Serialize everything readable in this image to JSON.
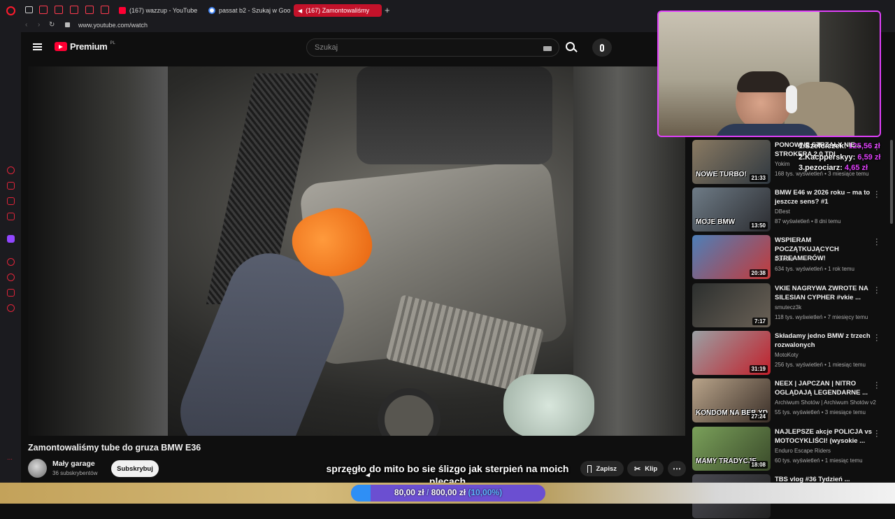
{
  "browser": {
    "tabs": [
      {
        "label": "(167) wazzup - YouTube",
        "favicon_color": "#ff0033"
      },
      {
        "label": "passat b2 - Szukaj w Goo",
        "favicon_color": "#4285f4"
      },
      {
        "label": "(167) Zamontowaliśmy",
        "favicon_color": "#ff0033",
        "active": true
      }
    ],
    "new_tab": "+",
    "url": "www.youtube.com/watch"
  },
  "yt": {
    "logo": "Premium",
    "region": "PL",
    "search_placeholder": "Szukaj"
  },
  "video": {
    "title": "Zamontowaliśmy tube do gruza BMW E36",
    "channel": "Mały garage",
    "subscribers": "36 subskrybentów",
    "subscribe_label": "Subskrybuj",
    "save_label": "Zapisz",
    "clip_label": "Klip"
  },
  "overlay": {
    "caption_line1": "sprzęgło do mito bo sie ślizgo jak sterpień na moich",
    "caption_line2": "plecach",
    "donation_text": "80,00 zł",
    "donation_separator": "/",
    "donation_goal": "800,00 zł",
    "donation_percent": "(10,00%)",
    "donation_progress": 0.1,
    "leaderboard": [
      {
        "name": "1.Szefciczek:",
        "amount": "125,56 zł"
      },
      {
        "name": "2.Kacpperskyy:",
        "amount": "6,59 zł"
      },
      {
        "name": "3.pezociarz:",
        "amount": "4,65 zł"
      }
    ]
  },
  "sidebar": {
    "items": [
      {
        "title": "PONOWNE STRZAŁY NIE... STROKERA 2.0 TDI",
        "channel": "Yokim",
        "meta": "168 tys. wyświetleń • 3 miesiące temu",
        "duration": "21:33",
        "thumb_text": "NOWE TURBO!",
        "thumb_colors": [
          "#8a7a62",
          "#2f3840"
        ]
      },
      {
        "title": "BMW E46 w 2026 roku – ma to jeszcze sens? #1",
        "channel": "DBest",
        "meta": "87 wyświetleń • 8 dni temu",
        "duration": "13:50",
        "thumb_text": "MOJE BMW",
        "thumb_colors": [
          "#6e7b86",
          "#2b2c30"
        ]
      },
      {
        "title": "WSPIERAM POCZĄTKUJĄCYCH STREAMERÓW!",
        "channel": "Dzinold",
        "meta": "634 tys. wyświetleń • 1 rok temu",
        "duration": "20:38",
        "thumb_text": "",
        "thumb_colors": [
          "#4d7fb8",
          "#c43a3a"
        ]
      },
      {
        "title": "VKIE NAGRYWA ZWROTE NA SILESIAN CYPHER #vkie ...",
        "channel": "smutecz3k",
        "meta": "118 tys. wyświetleń • 7 miesięcy temu",
        "duration": "7:17",
        "thumb_text": "",
        "thumb_colors": [
          "#2c2f2e",
          "#6a6156"
        ]
      },
      {
        "title": "Składamy jedno BMW z trzech rozwalonych",
        "channel": "MotoKoty",
        "meta": "256 tys. wyświetleń • 1 miesiąc temu",
        "duration": "31:19",
        "thumb_text": "",
        "thumb_colors": [
          "#9aa0a4",
          "#c21f2a"
        ]
      },
      {
        "title": "NEEX | JAPCZAN | NITRO OGLĄDAJĄ LEGENDARNE ...",
        "channel": "Archiwum Shotów | Archiwum Shotów v2",
        "meta": "55 tys. wyświetleń • 3 miesiące temu",
        "duration": "27:24",
        "thumb_text": "KONDOM NA BEB XD",
        "thumb_colors": [
          "#b9a48a",
          "#3a2f28"
        ]
      },
      {
        "title": "NAJLEPSZE akcje POLICJA vs MOTOCYKLIŚCI! (wysokie ...",
        "channel": "Enduro Escape Riders",
        "meta": "60 tys. wyświetleń • 1 miesiąc temu",
        "duration": "18:08",
        "thumb_text": "MAMY TRADYCJE",
        "thumb_colors": [
          "#7aa05a",
          "#3a4a2a"
        ]
      },
      {
        "title": "TBS vlog #36 Tydzień ...",
        "channel": "",
        "meta": "",
        "duration": "",
        "thumb_text": "",
        "thumb_colors": [
          "#4a4a52",
          "#222"
        ]
      }
    ]
  }
}
